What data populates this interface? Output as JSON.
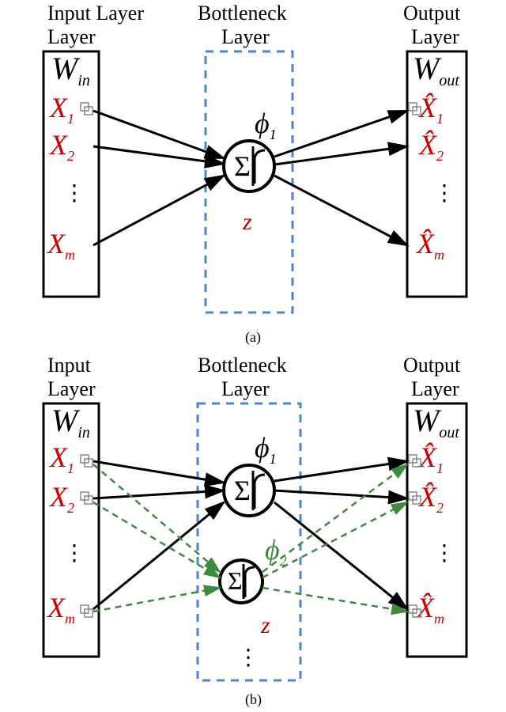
{
  "labels": {
    "input_layer": "Input Layer",
    "bottleneck_layer": "Bottleneck Layer",
    "output_layer": "Output Layer",
    "w_in": "W",
    "w_in_sub": "in",
    "w_out": "W",
    "w_out_sub": "out",
    "x1": "X",
    "x1_sub": "1",
    "x2": "X",
    "x2_sub": "2",
    "xm": "X",
    "xm_sub": "m",
    "xhat1": "X̂",
    "xhat1_sub": "1",
    "xhat2": "X̂",
    "xhat2_sub": "2",
    "xhatm": "X̂",
    "xhatm_sub": "m",
    "phi1": "ϕ",
    "phi1_sub": "1",
    "phi2": "ϕ",
    "phi2_sub": "2",
    "z": "z",
    "sigma": "Σ",
    "separator": "|",
    "dots": "⋮",
    "caption_a": "(a)",
    "caption_b": "(b)"
  },
  "chart_data": [
    {
      "type": "diagram",
      "title": "Autoencoder with single bottleneck neuron",
      "input_layer": {
        "weights": "W_in",
        "nodes": [
          "X_1",
          "X_2",
          "...",
          "X_m"
        ]
      },
      "bottleneck_layer": {
        "nodes": [
          {
            "name": "phi_1",
            "function": "sum+activation"
          }
        ],
        "output_var": "z"
      },
      "output_layer": {
        "weights": "W_out",
        "nodes": [
          "X_hat_1",
          "X_hat_2",
          "...",
          "X_hat_m"
        ]
      },
      "edges": [
        {
          "from": "X_1",
          "to": "phi_1"
        },
        {
          "from": "X_2",
          "to": "phi_1"
        },
        {
          "from": "X_m",
          "to": "phi_1"
        },
        {
          "from": "phi_1",
          "to": "X_hat_1"
        },
        {
          "from": "phi_1",
          "to": "X_hat_2"
        },
        {
          "from": "phi_1",
          "to": "X_hat_m"
        }
      ],
      "caption": "(a)"
    },
    {
      "type": "diagram",
      "title": "Autoencoder with two bottleneck neurons",
      "input_layer": {
        "weights": "W_in",
        "nodes": [
          "X_1",
          "X_2",
          "...",
          "X_m"
        ]
      },
      "bottleneck_layer": {
        "nodes": [
          {
            "name": "phi_1",
            "function": "sum+activation",
            "color": "black"
          },
          {
            "name": "phi_2",
            "function": "sum+activation",
            "color": "green"
          }
        ],
        "output_var": "z"
      },
      "output_layer": {
        "weights": "W_out",
        "nodes": [
          "X_hat_1",
          "X_hat_2",
          "...",
          "X_hat_m"
        ]
      },
      "edges": [
        {
          "from": "X_1",
          "to": "phi_1",
          "style": "solid"
        },
        {
          "from": "X_2",
          "to": "phi_1",
          "style": "solid"
        },
        {
          "from": "X_m",
          "to": "phi_1",
          "style": "solid"
        },
        {
          "from": "X_1",
          "to": "phi_2",
          "style": "dashed"
        },
        {
          "from": "X_2",
          "to": "phi_2",
          "style": "dashed"
        },
        {
          "from": "X_m",
          "to": "phi_2",
          "style": "dashed"
        },
        {
          "from": "phi_1",
          "to": "X_hat_1",
          "style": "solid"
        },
        {
          "from": "phi_1",
          "to": "X_hat_2",
          "style": "solid"
        },
        {
          "from": "phi_1",
          "to": "X_hat_m",
          "style": "solid"
        },
        {
          "from": "phi_2",
          "to": "X_hat_1",
          "style": "dashed"
        },
        {
          "from": "phi_2",
          "to": "X_hat_2",
          "style": "dashed"
        },
        {
          "from": "phi_2",
          "to": "X_hat_m",
          "style": "dashed"
        }
      ],
      "caption": "(b)"
    }
  ]
}
